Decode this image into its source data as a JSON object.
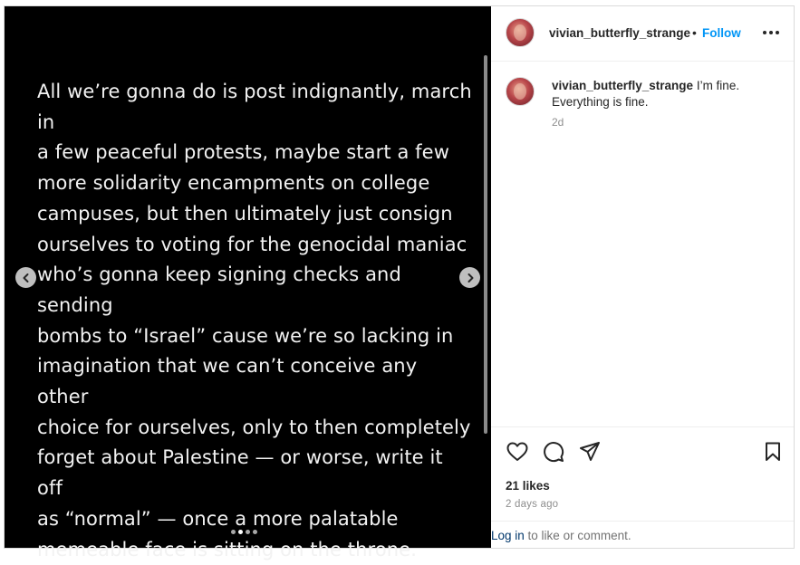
{
  "post": {
    "slide_text": "All we’re gonna do is post indignantly, march in\na few peaceful protests, maybe start a few\nmore solidarity encampments on college\ncampuses, but then ultimately just consign\nourselves to voting for the genocidal maniac\nwho’s gonna keep signing checks and sending\nbombs to “Israel” cause we’re so lacking in\nimagination that we can’t conceive any other\nchoice for ourselves, only to then completely\nforget about Palestine — or worse, write it off\nas “normal” — once a more palatable\nmemeable face is sitting on the throne.",
    "carousel": {
      "total_slides": 4,
      "active_slide": 2
    }
  },
  "header": {
    "username": "vivian_butterfly_strange",
    "separator": "•",
    "follow_label": "Follow",
    "more_icon": "more-icon"
  },
  "caption": {
    "username": "vivian_butterfly_strange",
    "text": " I’m fine. Everything is fine.",
    "time": "2d"
  },
  "actions": {
    "icons": [
      "heart-icon",
      "comment-icon",
      "share-icon",
      "bookmark-icon"
    ],
    "likes": "21 likes",
    "posted": "2 days ago"
  },
  "login": {
    "link_label": "Log in",
    "suffix": " to like or comment."
  },
  "colors": {
    "accent": "#0095f6",
    "media_background": "#000000",
    "link": "#00376b"
  }
}
